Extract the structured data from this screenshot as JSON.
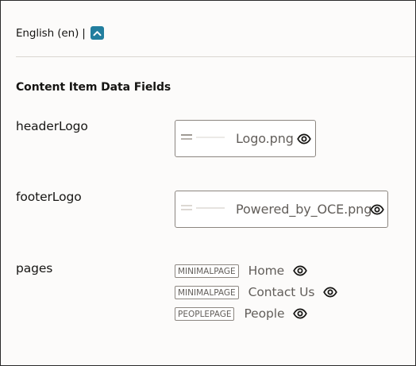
{
  "language": {
    "label": "English (en)",
    "separator": "|"
  },
  "section_title": "Content Item Data Fields",
  "fields": {
    "header_logo": {
      "label": "headerLogo",
      "file_name": "Logo.png"
    },
    "footer_logo": {
      "label": "footerLogo",
      "file_name": "Powered_by_OCE.png"
    },
    "pages": {
      "label": "pages",
      "items": [
        {
          "type": "MINIMALPAGE",
          "name": "Home"
        },
        {
          "type": "MINIMALPAGE",
          "name": "Contact Us"
        },
        {
          "type": "PEOPLEPAGE",
          "name": "People"
        }
      ]
    }
  },
  "colors": {
    "accent": "#227e9e",
    "text": "#161513",
    "muted_text": "#625e5a",
    "border": "#8c8680",
    "background": "#fcfbfa"
  },
  "icons": {
    "collapse": "chevron-up-icon",
    "preview": "eye-icon"
  }
}
